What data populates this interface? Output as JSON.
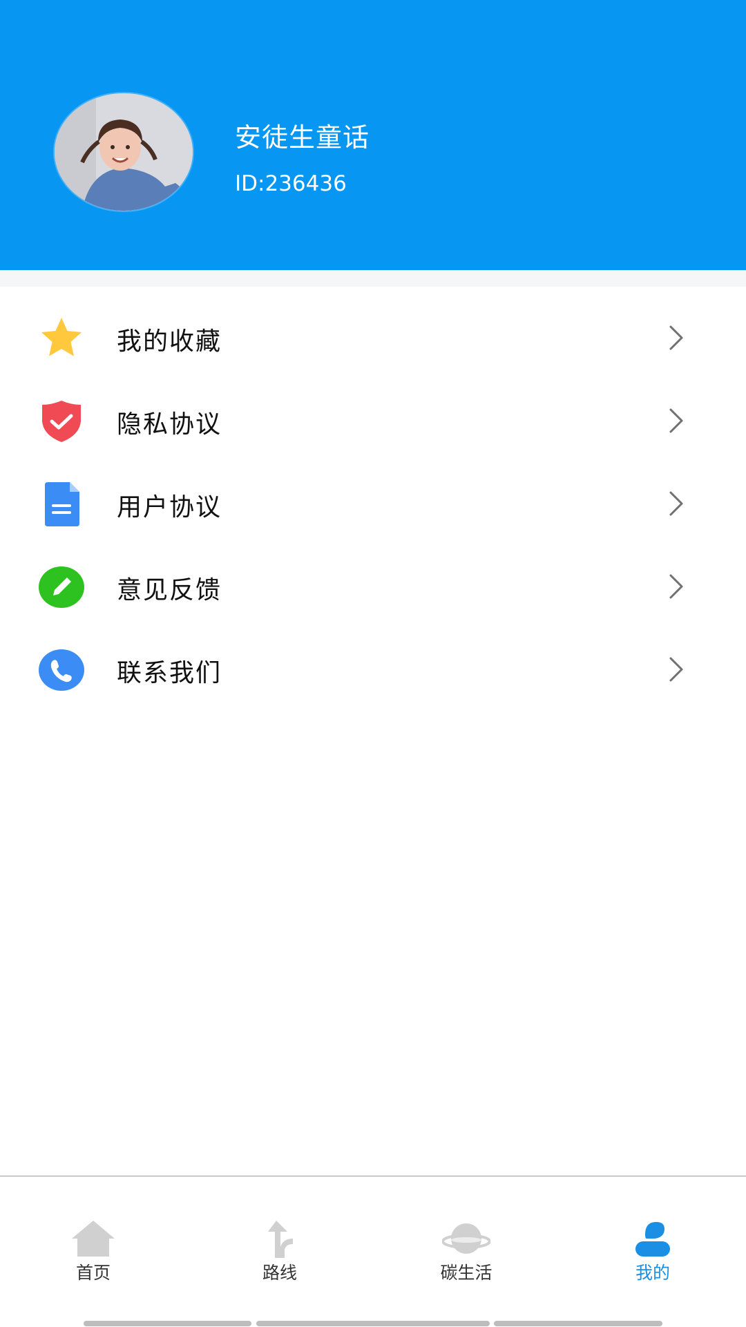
{
  "profile": {
    "name": "安徒生童话",
    "id_text": "ID:236436"
  },
  "menu": [
    {
      "label": "我的收藏",
      "icon": "star-icon",
      "color": "#FFC83D"
    },
    {
      "label": "隐私协议",
      "icon": "shield-check-icon",
      "color": "#F04A55"
    },
    {
      "label": "用户协议",
      "icon": "document-icon",
      "color": "#3C8CF5"
    },
    {
      "label": "意见反馈",
      "icon": "pencil-icon",
      "color": "#2DC21F"
    },
    {
      "label": "联系我们",
      "icon": "phone-icon",
      "color": "#3C8CF5"
    }
  ],
  "tabbar": {
    "tabs": [
      {
        "label": "首页",
        "icon": "home-icon",
        "active": false
      },
      {
        "label": "路线",
        "icon": "route-icon",
        "active": false
      },
      {
        "label": "碳生活",
        "icon": "planet-icon",
        "active": false
      },
      {
        "label": "我的",
        "icon": "user-icon",
        "active": true
      }
    ]
  },
  "colors": {
    "header": "#0796F2",
    "active_tab": "#1A8FE3",
    "inactive_icon": "#D0D0D0"
  }
}
